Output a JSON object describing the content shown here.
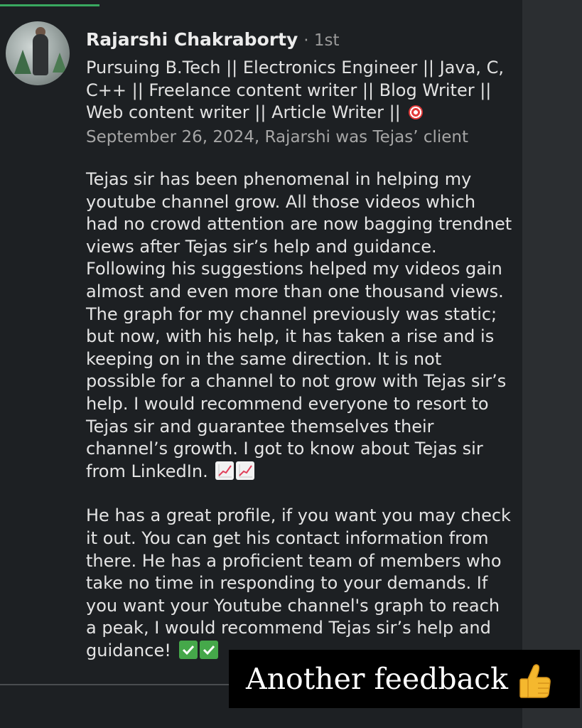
{
  "profile": {
    "name": "Rajarshi Chakraborty",
    "degree": "· 1st",
    "headline": "Pursuing B.Tech || Electronics Engineer || Java, C, C++ || Freelance content writer || Blog Writer || Web content writer || Article Writer ||",
    "headline_icon": "direct-hit-target-emoji",
    "meta": "September 26, 2024, Rajarshi was Tejas’ client",
    "avatar_icon": "profile-photo"
  },
  "recommendation": {
    "paragraph1": "Tejas sir has been phenomenal in helping my youtube channel grow. All those videos which had no crowd attention are now bagging trendnet views after Tejas sir’s help and guidance. Following his suggestions helped my videos gain almost and even more than one thousand views. The graph for my channel previously was static; but now, with his help, it has taken a rise and is keeping on in the same direction. It is not possible for a channel to not grow with Tejas sir’s help. I would recommend everyone to resort to Tejas sir and guarantee themselves their channel’s growth. I got to know about Tejas sir from LinkedIn.",
    "paragraph1_icons": [
      "chart-increasing-emoji",
      "chart-increasing-emoji"
    ],
    "paragraph2": "He has a great profile, if you want you may check it out. You can get his contact information from there. He has a proficient team of members who take no time in responding to your demands. If you want your Youtube channel's graph to reach a peak, I would recommend Tejas sir’s help and guidance!",
    "paragraph2_icons": [
      "check-mark-button-emoji",
      "check-mark-button-emoji"
    ]
  },
  "overlay": {
    "caption": "Another feedback",
    "caption_icon": "thumbs-up-emoji"
  },
  "colors": {
    "background": "#1d2023",
    "right_strip": "#2b2e31",
    "top_accent": "#3aa860",
    "caption_bg": "#000000"
  }
}
